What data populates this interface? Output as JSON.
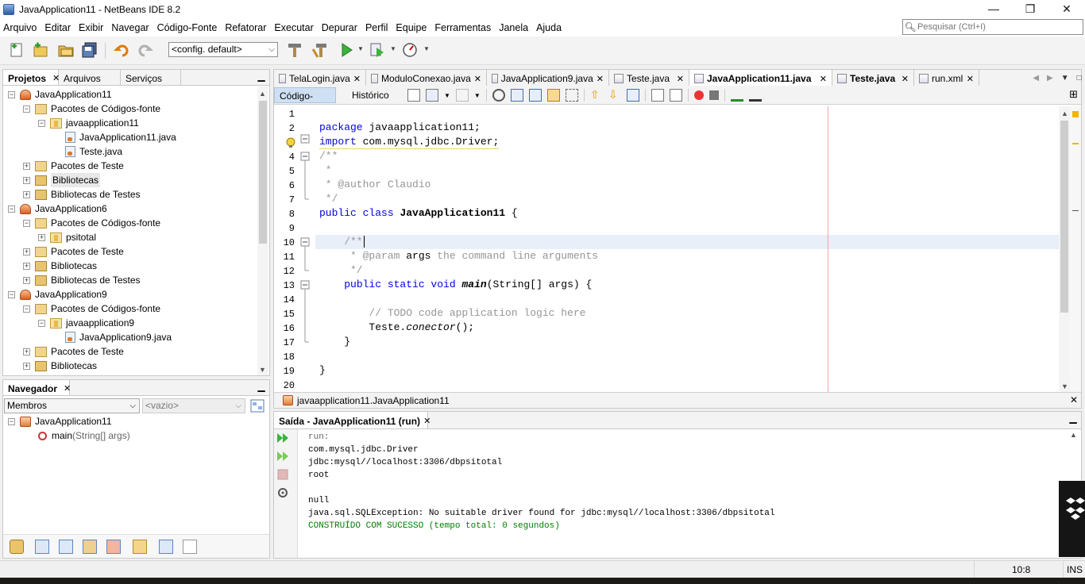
{
  "window": {
    "title": "JavaApplication11 - NetBeans IDE 8.2",
    "minimize": "—",
    "maximize": "❐",
    "close": "✕"
  },
  "menu": [
    "Arquivo",
    "Editar",
    "Exibir",
    "Navegar",
    "Código-Fonte",
    "Refatorar",
    "Executar",
    "Depurar",
    "Perfil",
    "Equipe",
    "Ferramentas",
    "Janela",
    "Ajuda"
  ],
  "search": {
    "placeholder": "Pesquisar (Ctrl+I)"
  },
  "toolbar": {
    "config_value": "<config. default>"
  },
  "projects_panel": {
    "tabs": [
      "Projetos",
      "Arquivos",
      "Serviços"
    ],
    "tree": [
      {
        "label": "JavaApplication11",
        "kind": "project",
        "depth": 0
      },
      {
        "label": "Pacotes de Códigos-fonte",
        "kind": "srcpkgs",
        "depth": 1
      },
      {
        "label": "javaapplication11",
        "kind": "package",
        "depth": 2
      },
      {
        "label": "JavaApplication11.java",
        "kind": "java",
        "depth": 3
      },
      {
        "label": "Teste.java",
        "kind": "java",
        "depth": 3
      },
      {
        "label": "Pacotes de Teste",
        "kind": "srcpkgs",
        "depth": 1
      },
      {
        "label": "Bibliotecas",
        "kind": "lib",
        "depth": 1
      },
      {
        "label": "Bibliotecas de Testes",
        "kind": "lib",
        "depth": 1
      },
      {
        "label": "JavaApplication6",
        "kind": "project",
        "depth": 0
      },
      {
        "label": "Pacotes de Códigos-fonte",
        "kind": "srcpkgs",
        "depth": 1
      },
      {
        "label": "psitotal",
        "kind": "package",
        "depth": 2
      },
      {
        "label": "Pacotes de Teste",
        "kind": "srcpkgs",
        "depth": 1
      },
      {
        "label": "Bibliotecas",
        "kind": "lib",
        "depth": 1
      },
      {
        "label": "Bibliotecas de Testes",
        "kind": "lib",
        "depth": 1
      },
      {
        "label": "JavaApplication9",
        "kind": "project",
        "depth": 0
      },
      {
        "label": "Pacotes de Códigos-fonte",
        "kind": "srcpkgs",
        "depth": 1
      },
      {
        "label": "javaapplication9",
        "kind": "package",
        "depth": 2
      },
      {
        "label": "JavaApplication9.java",
        "kind": "java",
        "depth": 3
      },
      {
        "label": "Pacotes de Teste",
        "kind": "srcpkgs",
        "depth": 1
      },
      {
        "label": "Bibliotecas",
        "kind": "lib",
        "depth": 1
      }
    ]
  },
  "navigator": {
    "title": "Navegador",
    "filter": "Membros",
    "filter2": "<vazio>",
    "root": "JavaApplication11",
    "method": "main",
    "method_params": "(String[] args)"
  },
  "editor": {
    "tabs": [
      {
        "label": "TelaLogin.java",
        "active": false
      },
      {
        "label": "ModuloConexao.java",
        "active": false
      },
      {
        "label": "JavaApplication9.java",
        "active": false
      },
      {
        "label": "Teste.java",
        "active": false
      },
      {
        "label": "JavaApplication11.java",
        "active": true
      },
      {
        "label": "Teste.java",
        "active": false,
        "bold": true
      },
      {
        "label": "run.xml",
        "active": false
      }
    ],
    "view_source": "Código-Fonte",
    "view_history": "Histórico",
    "line_numbers": [
      "1",
      "2",
      "3",
      "4",
      "5",
      "6",
      "7",
      "8",
      "9",
      "10",
      "11",
      "12",
      "13",
      "14",
      "15",
      "16",
      "17",
      "18",
      "19",
      "20"
    ],
    "breadcrumb": "javaapplication11.JavaApplication11"
  },
  "output": {
    "title": "Saída - JavaApplication11 (run)",
    "lines": [
      {
        "text": "run:",
        "style": "gray"
      },
      {
        "text": "com.mysql.jdbc.Driver",
        "style": "normal"
      },
      {
        "text": "jdbc:mysql//localhost:3306/dbpsitotal",
        "style": "normal"
      },
      {
        "text": "root",
        "style": "normal"
      },
      {
        "text": "",
        "style": "normal"
      },
      {
        "text": "null",
        "style": "normal"
      },
      {
        "text": "java.sql.SQLException: No suitable driver found for jdbc:mysql//localhost:3306/dbpsitotal",
        "style": "normal"
      },
      {
        "text": "CONSTRUÍDO COM SUCESSO (tempo total: 0 segundos)",
        "style": "green"
      }
    ]
  },
  "status": {
    "position": "10:8",
    "mode": "INS"
  }
}
